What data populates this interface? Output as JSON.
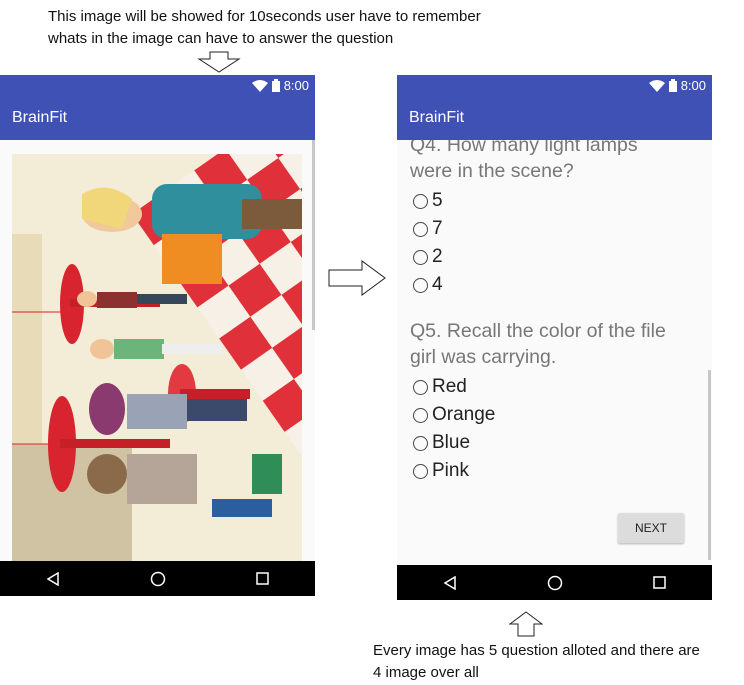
{
  "annotations": {
    "top_note_line1": "This image will be showed for 10seconds user have to remember",
    "top_note_line2": "whats in the image can have to answer the question",
    "bottom_note_line1": "Every image has 5 question alloted and there are",
    "bottom_note_line2": "4 image over all"
  },
  "left_screen": {
    "status_time": "8:00",
    "app_title": "BrainFit"
  },
  "right_screen": {
    "status_time": "8:00",
    "app_title": "BrainFit",
    "q4": {
      "line1": "Q4. How many light lamps",
      "line2": "were in the scene?",
      "options": [
        "5",
        "7",
        "2",
        "4"
      ]
    },
    "q5": {
      "line1": "Q5. Recall the color of the file",
      "line2": "girl was carrying.",
      "options": [
        "Red",
        "Orange",
        "Blue",
        "Pink"
      ]
    },
    "next_label": "NEXT"
  },
  "colors": {
    "app_bar": "#3f51b5",
    "nav_bar": "#000000"
  },
  "icons": [
    "wifi-icon",
    "battery-icon",
    "back-icon",
    "home-icon",
    "recents-icon",
    "arrow-down-icon",
    "arrow-right-icon",
    "arrow-up-icon"
  ]
}
